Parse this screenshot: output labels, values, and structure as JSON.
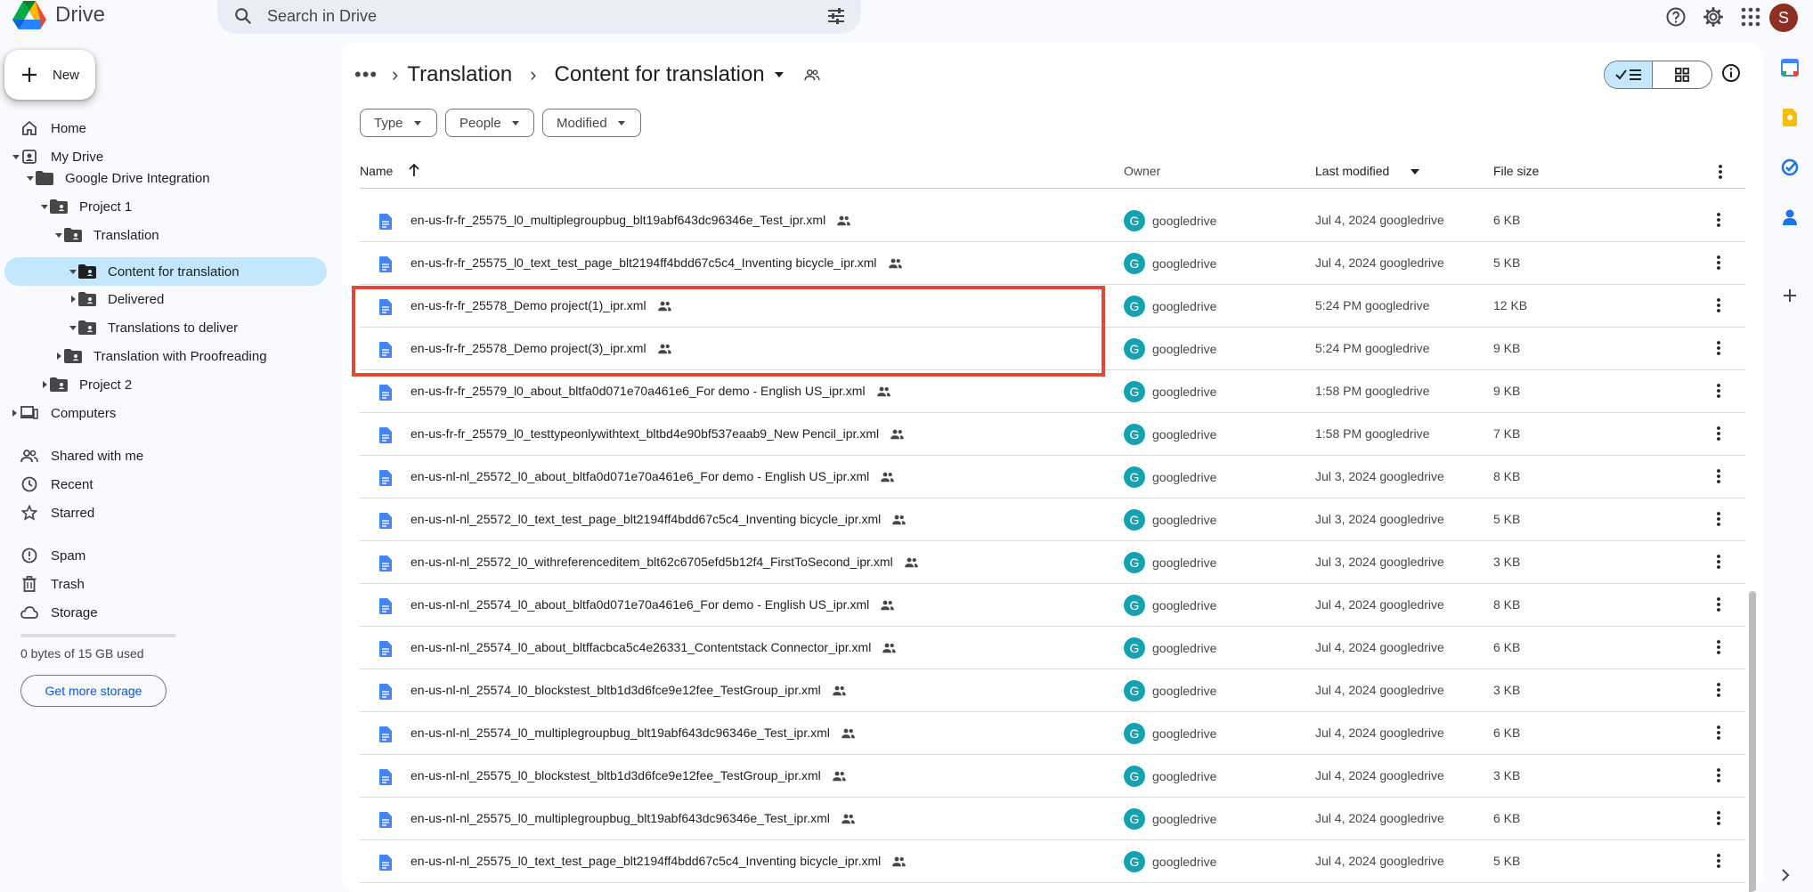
{
  "app": {
    "name": "Drive"
  },
  "search": {
    "placeholder": "Search in Drive"
  },
  "topbar": {
    "avatar_letter": "S"
  },
  "sidebar": {
    "new_label": "New",
    "nav": [
      {
        "label": "Home"
      },
      {
        "label": "My Drive"
      },
      {
        "label": "Google Drive Integration"
      },
      {
        "label": "Project 1"
      },
      {
        "label": "Translation"
      },
      {
        "label": "Content for translation"
      },
      {
        "label": "Delivered"
      },
      {
        "label": "Translations to deliver"
      },
      {
        "label": "Translation with Proofreading"
      },
      {
        "label": "Project 2"
      },
      {
        "label": "Computers"
      },
      {
        "label": "Shared with me"
      },
      {
        "label": "Recent"
      },
      {
        "label": "Starred"
      },
      {
        "label": "Spam"
      },
      {
        "label": "Trash"
      },
      {
        "label": "Storage"
      }
    ],
    "storage_text": "0 bytes of 15 GB used",
    "storage_button": "Get more storage"
  },
  "breadcrumb": {
    "dots": "•••",
    "parent": "Translation",
    "current": "Content for translation"
  },
  "filters": {
    "type": "Type",
    "people": "People",
    "modified": "Modified"
  },
  "table": {
    "headers": {
      "name": "Name",
      "owner": "Owner",
      "modified": "Last modified",
      "size": "File size"
    },
    "rows": [
      {
        "name": "en-us-fr-fr_25575_l0_multiplegroupbug_blt19abf643dc96346e_Test_ipr.xml",
        "owner": "googledrive",
        "modified": "Jul 4, 2024 googledrive",
        "size": "6 KB"
      },
      {
        "name": "en-us-fr-fr_25575_l0_text_test_page_blt2194ff4bdd67c5c4_Inventing bicycle_ipr.xml",
        "owner": "googledrive",
        "modified": "Jul 4, 2024 googledrive",
        "size": "5 KB"
      },
      {
        "name": "en-us-fr-fr_25578_Demo project(1)_ipr.xml",
        "owner": "googledrive",
        "modified": "5:24 PM googledrive",
        "size": "12 KB"
      },
      {
        "name": "en-us-fr-fr_25578_Demo project(3)_ipr.xml",
        "owner": "googledrive",
        "modified": "5:24 PM googledrive",
        "size": "9 KB"
      },
      {
        "name": "en-us-fr-fr_25579_l0_about_bltfa0d071e70a461e6_For demo - English US_ipr.xml",
        "owner": "googledrive",
        "modified": "1:58 PM googledrive",
        "size": "9 KB"
      },
      {
        "name": "en-us-fr-fr_25579_l0_testtypeonlywithtext_bltbd4e90bf537eaab9_New Pencil_ipr.xml",
        "owner": "googledrive",
        "modified": "1:58 PM googledrive",
        "size": "7 KB"
      },
      {
        "name": "en-us-nl-nl_25572_l0_about_bltfa0d071e70a461e6_For demo - English US_ipr.xml",
        "owner": "googledrive",
        "modified": "Jul 3, 2024 googledrive",
        "size": "8 KB"
      },
      {
        "name": "en-us-nl-nl_25572_l0_text_test_page_blt2194ff4bdd67c5c4_Inventing bicycle_ipr.xml",
        "owner": "googledrive",
        "modified": "Jul 3, 2024 googledrive",
        "size": "5 KB"
      },
      {
        "name": "en-us-nl-nl_25572_l0_withreferenceditem_blt62c6705efd5b12f4_FirstToSecond_ipr.xml",
        "owner": "googledrive",
        "modified": "Jul 3, 2024 googledrive",
        "size": "3 KB"
      },
      {
        "name": "en-us-nl-nl_25574_l0_about_bltfa0d071e70a461e6_For demo - English US_ipr.xml",
        "owner": "googledrive",
        "modified": "Jul 4, 2024 googledrive",
        "size": "8 KB"
      },
      {
        "name": "en-us-nl-nl_25574_l0_about_bltffacbca5c4e26331_Contentstack Connector_ipr.xml",
        "owner": "googledrive",
        "modified": "Jul 4, 2024 googledrive",
        "size": "6 KB"
      },
      {
        "name": "en-us-nl-nl_25574_l0_blockstest_bltb1d3d6fce9e12fee_TestGroup_ipr.xml",
        "owner": "googledrive",
        "modified": "Jul 4, 2024 googledrive",
        "size": "3 KB"
      },
      {
        "name": "en-us-nl-nl_25574_l0_multiplegroupbug_blt19abf643dc96346e_Test_ipr.xml",
        "owner": "googledrive",
        "modified": "Jul 4, 2024 googledrive",
        "size": "6 KB"
      },
      {
        "name": "en-us-nl-nl_25575_l0_blockstest_bltb1d3d6fce9e12fee_TestGroup_ipr.xml",
        "owner": "googledrive",
        "modified": "Jul 4, 2024 googledrive",
        "size": "3 KB"
      },
      {
        "name": "en-us-nl-nl_25575_l0_multiplegroupbug_blt19abf643dc96346e_Test_ipr.xml",
        "owner": "googledrive",
        "modified": "Jul 4, 2024 googledrive",
        "size": "6 KB"
      },
      {
        "name": "en-us-nl-nl_25575_l0_text_test_page_blt2194ff4bdd67c5c4_Inventing bicycle_ipr.xml",
        "owner": "googledrive",
        "modified": "Jul 4, 2024 googledrive",
        "size": "5 KB"
      }
    ]
  },
  "colors": {
    "accent": "#0b57d0",
    "selected_bg": "#c2e7ff",
    "highlight": "#e2483a",
    "doc_icon": "#4285f4",
    "owner_avatar": "#12a4af"
  },
  "icons": {
    "file": "doc-icon",
    "shared": "people-icon",
    "more": "more-vert-icon"
  }
}
